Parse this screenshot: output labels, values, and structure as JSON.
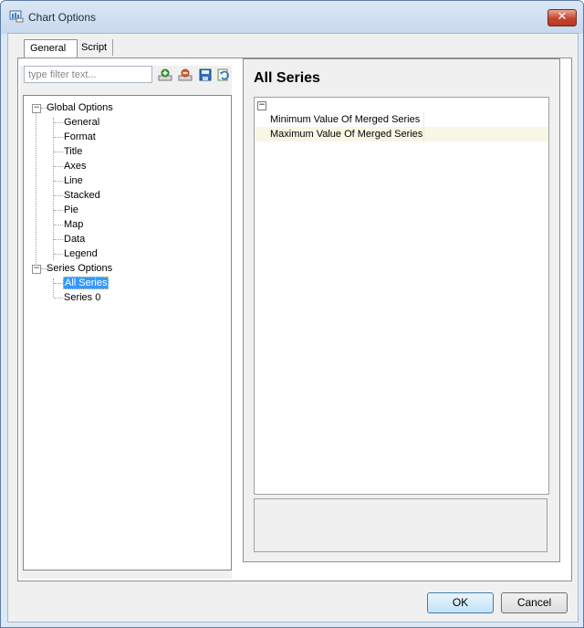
{
  "window": {
    "title": "Chart Options"
  },
  "tabs": [
    {
      "label": "General"
    },
    {
      "label": "Script"
    }
  ],
  "filter": {
    "placeholder": "type filter text..."
  },
  "toolbar_icons": [
    "expand-all-icon",
    "collapse-all-icon",
    "save-icon",
    "restore-icon"
  ],
  "tree": {
    "global_label": "Global Options",
    "global_children": [
      "General",
      "Format",
      "Title",
      "Axes",
      "Line",
      "Stacked",
      "Pie",
      "Map",
      "Data",
      "Legend"
    ],
    "series_label": "Series Options",
    "series_children": [
      "All Series",
      "Series 0"
    ],
    "selected": "All Series"
  },
  "panel": {
    "heading": "All Series",
    "properties": [
      {
        "name": "Minimum Value Of Merged Series",
        "value": ""
      },
      {
        "name": "Maximum Value Of Merged Series",
        "value": ""
      }
    ]
  },
  "buttons": {
    "ok": "OK",
    "cancel": "Cancel"
  },
  "colors": {
    "selection": "#3399ff",
    "close": "#c4452f",
    "highlight_row": "#f7f7e6"
  }
}
